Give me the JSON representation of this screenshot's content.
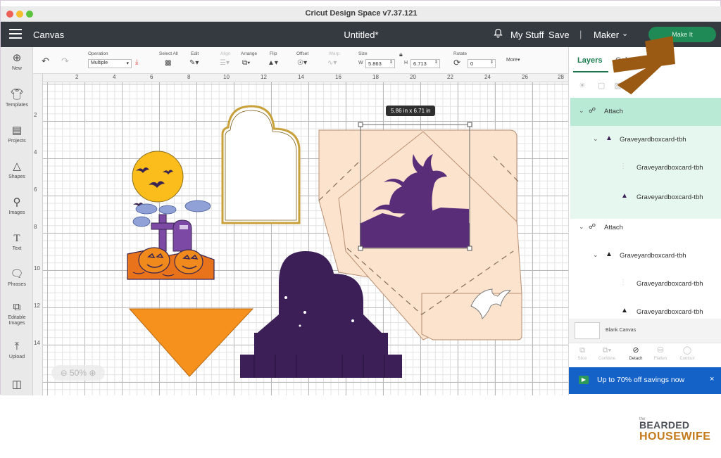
{
  "window": {
    "title": "Cricut Design Space  v7.37.121"
  },
  "header": {
    "section": "Canvas",
    "doc_title": "Untitled*",
    "my_stuff": "My Stuff",
    "save": "Save",
    "separator": "|",
    "machine": "Maker",
    "make_it": "Make It"
  },
  "sidebar": {
    "items": [
      {
        "label": "New",
        "icon": "plus-circle-icon"
      },
      {
        "label": "Templates",
        "icon": "shirt-icon"
      },
      {
        "label": "Projects",
        "icon": "clipboard-icon"
      },
      {
        "label": "Shapes",
        "icon": "shapes-icon"
      },
      {
        "label": "Images",
        "icon": "lightbulb-icon"
      },
      {
        "label": "Text",
        "icon": "text-icon"
      },
      {
        "label": "Phrases",
        "icon": "speech-bubble-icon"
      },
      {
        "label": "Editable Images",
        "icon": "crop-icon"
      },
      {
        "label": "Upload",
        "icon": "upload-icon"
      },
      {
        "label": "",
        "icon": "book-icon"
      }
    ]
  },
  "toolbar": {
    "operation_label": "Operation",
    "operation_value": "Multiple",
    "select_all": "Select All",
    "edit": "Edit",
    "align": "Align",
    "arrange": "Arrange",
    "flip": "Flip",
    "offset": "Offset",
    "wrap": "Warp",
    "size": "Size",
    "w_label": "W",
    "w_value": "5.863",
    "h_label": "H",
    "h_value": "6.713",
    "rotate": "Rotate",
    "rotate_value": "0",
    "more": "More"
  },
  "rulers": {
    "top": [
      "2",
      "4",
      "6",
      "8",
      "10",
      "12",
      "14",
      "16",
      "18",
      "20",
      "22",
      "24",
      "26",
      "28"
    ],
    "left": [
      "2",
      "4",
      "6",
      "8",
      "10",
      "12",
      "14"
    ]
  },
  "canvas": {
    "size_tag": "5.86  in x 6.71  in",
    "zoom": "50%"
  },
  "panel": {
    "tab_layers": "Layers",
    "tab_color": "Color",
    "layers": [
      {
        "label": "Attach",
        "depth": 0,
        "kind": "group",
        "highlight": "strong"
      },
      {
        "label": "Graveyardboxcard-tbh",
        "depth": 1,
        "kind": "group",
        "highlight": "light"
      },
      {
        "label": "Graveyardboxcard-tbh",
        "depth": 2,
        "kind": "item",
        "highlight": "light"
      },
      {
        "label": "Graveyardboxcard-tbh",
        "depth": 2,
        "kind": "item",
        "highlight": "light"
      },
      {
        "label": "Attach",
        "depth": 0,
        "kind": "group",
        "highlight": "none"
      },
      {
        "label": "Graveyardboxcard-tbh",
        "depth": 1,
        "kind": "group",
        "highlight": "none"
      },
      {
        "label": "Graveyardboxcard-tbh",
        "depth": 2,
        "kind": "item",
        "highlight": "none"
      },
      {
        "label": "Graveyardboxcard-tbh",
        "depth": 2,
        "kind": "item",
        "highlight": "none"
      }
    ],
    "blank_canvas": "Blank Canvas",
    "bottom_tools": [
      {
        "label": "Slice",
        "active": false
      },
      {
        "label": "Combine",
        "active": false
      },
      {
        "label": "Detach",
        "active": true
      },
      {
        "label": "Flatten",
        "active": false
      },
      {
        "label": "Contour",
        "active": false
      }
    ],
    "promo": "Up to 70% off savings now",
    "promo_close": "×"
  },
  "watermark": {
    "line1": "BEARDED",
    "line2": "HOUSEWIFE",
    "small": "the"
  },
  "colors": {
    "header_bg": "#343a40",
    "make_it": "#1f8a55",
    "layer_highlight": "#b9ead6",
    "promo_bg": "#1462c7",
    "card_peach": "#fbe3cd",
    "purple": "#4f2a67",
    "orange": "#f7911e",
    "arrow": "#9a5a14"
  }
}
